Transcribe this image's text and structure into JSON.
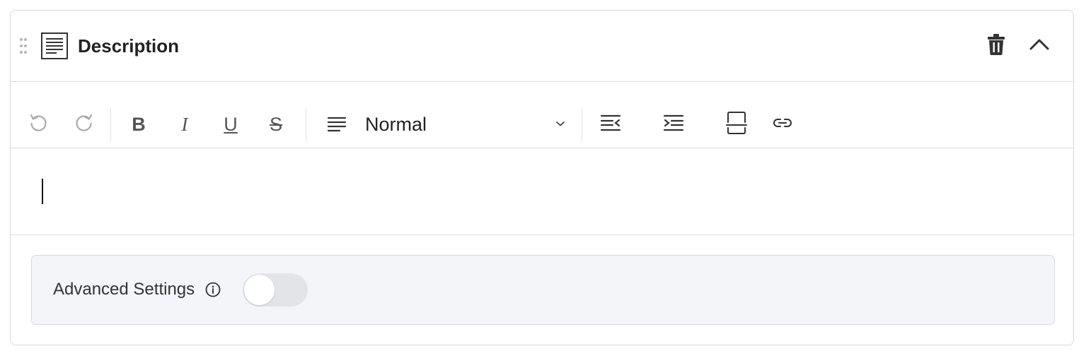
{
  "block": {
    "title": "Description",
    "icon": "document-lines-icon"
  },
  "toolbar": {
    "undo": "undo-icon",
    "redo": "redo-icon",
    "bold": "B",
    "italic": "I",
    "underline": "U",
    "strike": "S",
    "format_value": "Normal",
    "outdent": "outdent-icon",
    "indent": "indent-icon",
    "page_break": "page-break-icon",
    "link": "link-icon"
  },
  "editor": {
    "content": ""
  },
  "advanced": {
    "label": "Advanced Settings",
    "enabled": false
  },
  "colors": {
    "border": "#d9d9de",
    "panel_bg": "#f4f5f9",
    "toggle_off": "#e3e4e8",
    "icon": "#555555"
  }
}
